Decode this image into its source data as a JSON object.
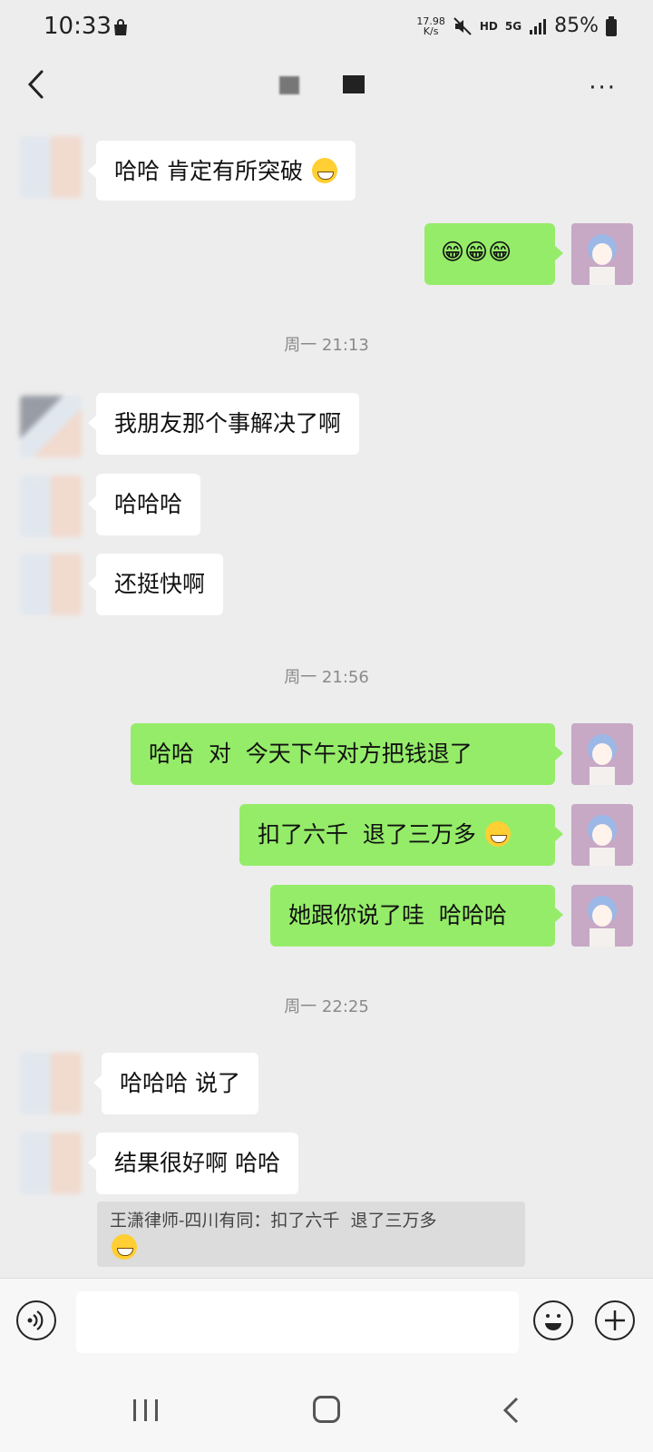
{
  "status_bar": {
    "time": "10:33",
    "net_speed_value": "17.98",
    "net_speed_unit": "K/s",
    "hd_label": "HD",
    "network_label": "5G",
    "battery": "85%"
  },
  "nav": {
    "more_label": "···"
  },
  "messages": [
    {
      "side": "in",
      "text": "哈哈 肯定有所突破"
    },
    {
      "side": "out",
      "text": "😁😁😁"
    },
    {
      "side": "time",
      "text": "周一 21:13"
    },
    {
      "side": "in",
      "text": "我朋友那个事解决了啊"
    },
    {
      "side": "in",
      "text": "哈哈哈"
    },
    {
      "side": "in",
      "text": "还挺快啊"
    },
    {
      "side": "time",
      "text": "周一 21:56"
    },
    {
      "side": "out",
      "text": "哈哈  对  今天下午对方把钱退了"
    },
    {
      "side": "out",
      "text": "扣了六千  退了三万多"
    },
    {
      "side": "out",
      "text": "她跟你说了哇  哈哈哈"
    },
    {
      "side": "time",
      "text": "周一 22:25"
    },
    {
      "side": "in",
      "text": "哈哈哈 说了"
    },
    {
      "side": "in",
      "text": "结果很好啊 哈哈"
    }
  ],
  "quote": {
    "text": "王潇律师-四川有同：扣了六千  退了三万多"
  },
  "input": {
    "value": "",
    "placeholder": ""
  },
  "colors": {
    "out_bubble": "#95ec69",
    "in_bubble": "#ffffff",
    "background": "#ededed"
  }
}
